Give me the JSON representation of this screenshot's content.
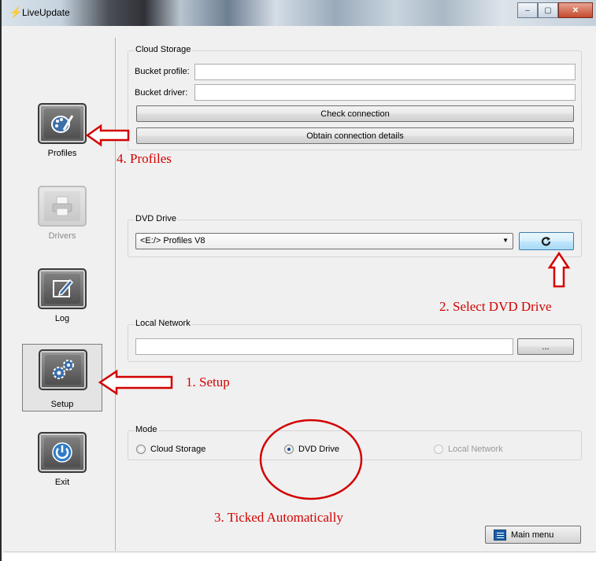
{
  "window": {
    "title": "LiveUpdate",
    "controls": {
      "minimize": "–",
      "maximize": "▢",
      "close": "✕"
    }
  },
  "sidebar": {
    "items": [
      {
        "label": "Profiles",
        "icon": "palette-icon",
        "state": "normal"
      },
      {
        "label": "Drivers",
        "icon": "printer-icon",
        "state": "disabled"
      },
      {
        "label": "Log",
        "icon": "edit-icon",
        "state": "normal"
      },
      {
        "label": "Setup",
        "icon": "gears-icon",
        "state": "active"
      },
      {
        "label": "Exit",
        "icon": "power-icon",
        "state": "normal"
      }
    ]
  },
  "cloud": {
    "title": "Cloud Storage",
    "bucket_profile_label": "Bucket profile:",
    "bucket_profile_value": "",
    "bucket_driver_label": "Bucket driver:",
    "bucket_driver_value": "",
    "check_button": "Check connection",
    "obtain_button": "Obtain connection details"
  },
  "dvd": {
    "title": "DVD Drive",
    "selected": "<E:/> Profiles V8",
    "refresh_icon": "refresh-icon"
  },
  "network": {
    "title": "Local Network",
    "path_value": "",
    "browse_button": "..."
  },
  "mode": {
    "title": "Mode",
    "options": [
      {
        "label": "Cloud Storage",
        "checked": false,
        "disabled": false
      },
      {
        "label": "DVD Drive",
        "checked": true,
        "disabled": false
      },
      {
        "label": "Local Network",
        "checked": false,
        "disabled": true
      }
    ]
  },
  "main_menu_button": "Main menu",
  "annotations": {
    "setup": "1. Setup",
    "select_dvd": "2. Select DVD Drive",
    "ticked": "3. Ticked Automatically",
    "profiles": "4. Profiles",
    "color": "#d30000"
  }
}
